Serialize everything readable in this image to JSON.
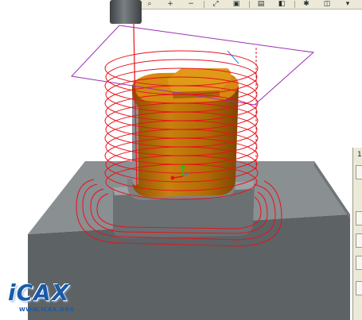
{
  "toolbar": {
    "buttons": [
      {
        "name": "zoom-window",
        "glyph": "⌕"
      },
      {
        "name": "zoom-in",
        "glyph": "+"
      },
      {
        "name": "zoom-out",
        "glyph": "−"
      },
      {
        "name": "refit",
        "glyph": "⤢"
      },
      {
        "name": "named-view",
        "glyph": "▣"
      },
      {
        "name": "view-manager",
        "glyph": "▤"
      },
      {
        "name": "shading",
        "glyph": "◧"
      },
      {
        "name": "spin-center",
        "glyph": "✱"
      },
      {
        "name": "display-style",
        "glyph": "◫"
      },
      {
        "name": "datum",
        "glyph": "▾"
      }
    ]
  },
  "side_panel": {
    "label": "1"
  },
  "logo": {
    "text": "iCAX",
    "url": "WWW.ICAX.ORG"
  },
  "colors": {
    "toolpath": "#e8121c",
    "workpiece_light": "#8a8f92",
    "workpiece_dark": "#5e6366",
    "part_orange": "#c47a0c",
    "part_orange_dark": "#8f5300",
    "plane": "#9a2fb4",
    "tool": "#555a5e"
  }
}
